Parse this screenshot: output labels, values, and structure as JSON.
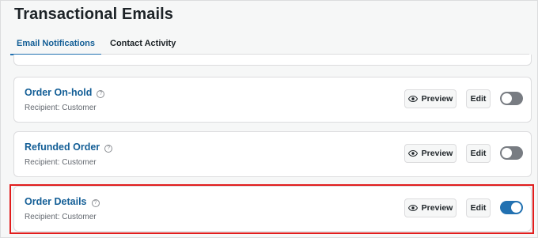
{
  "page": {
    "title": "Transactional Emails"
  },
  "tabs": [
    {
      "label": "Email Notifications",
      "active": true
    },
    {
      "label": "Contact Activity",
      "active": false
    }
  ],
  "emails": [
    {
      "title": "Order On-hold",
      "recipient": "Recipient: Customer",
      "preview_label": "Preview",
      "edit_label": "Edit",
      "enabled": false
    },
    {
      "title": "Refunded Order",
      "recipient": "Recipient: Customer",
      "preview_label": "Preview",
      "edit_label": "Edit",
      "enabled": false
    },
    {
      "title": "Order Details",
      "recipient": "Recipient: Customer",
      "preview_label": "Preview",
      "edit_label": "Edit",
      "enabled": true
    }
  ],
  "icons": {
    "help": "question-circle-icon",
    "preview": "eye-icon"
  },
  "colors": {
    "accent": "#2271b1",
    "link": "#135e96",
    "toggle_off": "#787c82",
    "highlight": "#e11d1d"
  }
}
